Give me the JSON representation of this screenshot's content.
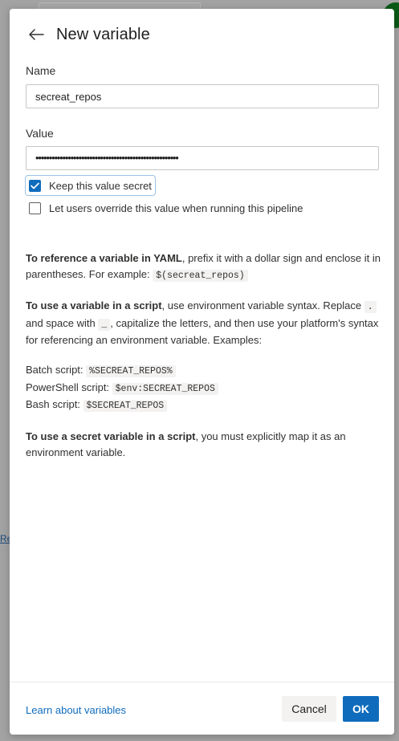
{
  "dialog": {
    "title": "New variable",
    "name_label": "Name",
    "name_value": "secreat_repos",
    "value_label": "Value",
    "value_masked": "•••••••••••••••••••••••••••••••••••••••••••••••••••••",
    "keep_secret_label": "Keep this value secret",
    "keep_secret_checked": true,
    "override_label": "Let users override this value when running this pipeline",
    "override_checked": false
  },
  "info": {
    "yaml_bold": "To reference a variable in YAML",
    "yaml_text": ", prefix it with a dollar sign and enclose it in parentheses. For example: ",
    "yaml_code": "$(secreat_repos)",
    "script_bold": "To use a variable in a script",
    "script_text1": ", use environment variable syntax. Replace ",
    "script_code_dot": ".",
    "script_text2": " and space with ",
    "script_code_underscore": "_",
    "script_text3": ", capitalize the letters, and then use your platform's syntax for referencing an environment variable. Examples:",
    "batch_label": "Batch script: ",
    "batch_code": "%SECREAT_REPOS%",
    "powershell_label": "PowerShell script: ",
    "powershell_code": "$env:SECREAT_REPOS",
    "bash_label": "Bash script: ",
    "bash_code": "$SECREAT_REPOS",
    "secret_bold": "To use a secret variable in a script",
    "secret_text": ", you must explicitly map it as an environment variable."
  },
  "footer": {
    "learn_link": "Learn about variables",
    "cancel_label": "Cancel",
    "ok_label": "OK"
  },
  "background": {
    "link_text": "Re"
  },
  "colors": {
    "accent": "#0f6cbd",
    "avatar": "#0b5a17"
  }
}
